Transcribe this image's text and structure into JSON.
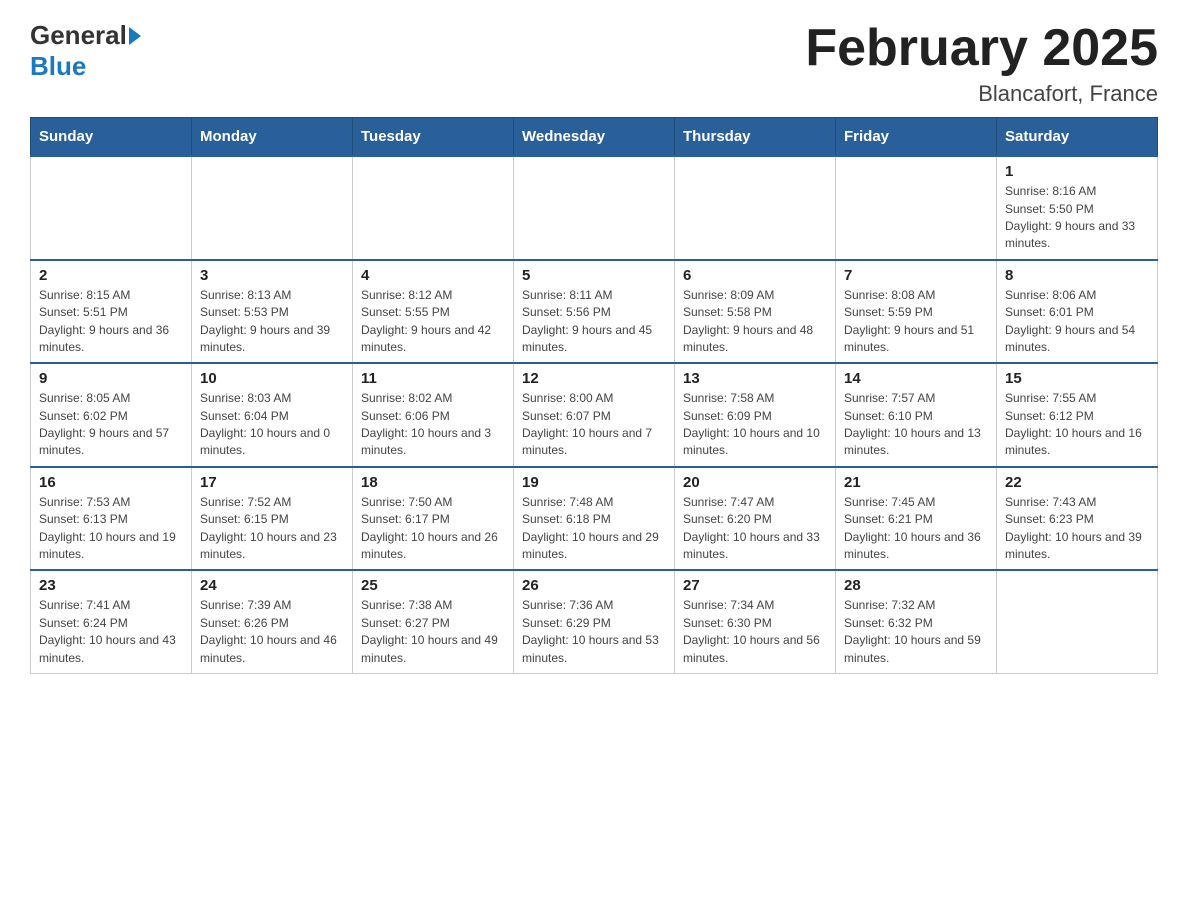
{
  "header": {
    "logo_general": "General",
    "logo_blue": "Blue",
    "month_title": "February 2025",
    "location": "Blancafort, France"
  },
  "days_of_week": [
    "Sunday",
    "Monday",
    "Tuesday",
    "Wednesday",
    "Thursday",
    "Friday",
    "Saturday"
  ],
  "weeks": [
    {
      "cells": [
        {
          "day": "",
          "info": ""
        },
        {
          "day": "",
          "info": ""
        },
        {
          "day": "",
          "info": ""
        },
        {
          "day": "",
          "info": ""
        },
        {
          "day": "",
          "info": ""
        },
        {
          "day": "",
          "info": ""
        },
        {
          "day": "1",
          "info": "Sunrise: 8:16 AM\nSunset: 5:50 PM\nDaylight: 9 hours and 33 minutes."
        }
      ]
    },
    {
      "cells": [
        {
          "day": "2",
          "info": "Sunrise: 8:15 AM\nSunset: 5:51 PM\nDaylight: 9 hours and 36 minutes."
        },
        {
          "day": "3",
          "info": "Sunrise: 8:13 AM\nSunset: 5:53 PM\nDaylight: 9 hours and 39 minutes."
        },
        {
          "day": "4",
          "info": "Sunrise: 8:12 AM\nSunset: 5:55 PM\nDaylight: 9 hours and 42 minutes."
        },
        {
          "day": "5",
          "info": "Sunrise: 8:11 AM\nSunset: 5:56 PM\nDaylight: 9 hours and 45 minutes."
        },
        {
          "day": "6",
          "info": "Sunrise: 8:09 AM\nSunset: 5:58 PM\nDaylight: 9 hours and 48 minutes."
        },
        {
          "day": "7",
          "info": "Sunrise: 8:08 AM\nSunset: 5:59 PM\nDaylight: 9 hours and 51 minutes."
        },
        {
          "day": "8",
          "info": "Sunrise: 8:06 AM\nSunset: 6:01 PM\nDaylight: 9 hours and 54 minutes."
        }
      ]
    },
    {
      "cells": [
        {
          "day": "9",
          "info": "Sunrise: 8:05 AM\nSunset: 6:02 PM\nDaylight: 9 hours and 57 minutes."
        },
        {
          "day": "10",
          "info": "Sunrise: 8:03 AM\nSunset: 6:04 PM\nDaylight: 10 hours and 0 minutes."
        },
        {
          "day": "11",
          "info": "Sunrise: 8:02 AM\nSunset: 6:06 PM\nDaylight: 10 hours and 3 minutes."
        },
        {
          "day": "12",
          "info": "Sunrise: 8:00 AM\nSunset: 6:07 PM\nDaylight: 10 hours and 7 minutes."
        },
        {
          "day": "13",
          "info": "Sunrise: 7:58 AM\nSunset: 6:09 PM\nDaylight: 10 hours and 10 minutes."
        },
        {
          "day": "14",
          "info": "Sunrise: 7:57 AM\nSunset: 6:10 PM\nDaylight: 10 hours and 13 minutes."
        },
        {
          "day": "15",
          "info": "Sunrise: 7:55 AM\nSunset: 6:12 PM\nDaylight: 10 hours and 16 minutes."
        }
      ]
    },
    {
      "cells": [
        {
          "day": "16",
          "info": "Sunrise: 7:53 AM\nSunset: 6:13 PM\nDaylight: 10 hours and 19 minutes."
        },
        {
          "day": "17",
          "info": "Sunrise: 7:52 AM\nSunset: 6:15 PM\nDaylight: 10 hours and 23 minutes."
        },
        {
          "day": "18",
          "info": "Sunrise: 7:50 AM\nSunset: 6:17 PM\nDaylight: 10 hours and 26 minutes."
        },
        {
          "day": "19",
          "info": "Sunrise: 7:48 AM\nSunset: 6:18 PM\nDaylight: 10 hours and 29 minutes."
        },
        {
          "day": "20",
          "info": "Sunrise: 7:47 AM\nSunset: 6:20 PM\nDaylight: 10 hours and 33 minutes."
        },
        {
          "day": "21",
          "info": "Sunrise: 7:45 AM\nSunset: 6:21 PM\nDaylight: 10 hours and 36 minutes."
        },
        {
          "day": "22",
          "info": "Sunrise: 7:43 AM\nSunset: 6:23 PM\nDaylight: 10 hours and 39 minutes."
        }
      ]
    },
    {
      "cells": [
        {
          "day": "23",
          "info": "Sunrise: 7:41 AM\nSunset: 6:24 PM\nDaylight: 10 hours and 43 minutes."
        },
        {
          "day": "24",
          "info": "Sunrise: 7:39 AM\nSunset: 6:26 PM\nDaylight: 10 hours and 46 minutes."
        },
        {
          "day": "25",
          "info": "Sunrise: 7:38 AM\nSunset: 6:27 PM\nDaylight: 10 hours and 49 minutes."
        },
        {
          "day": "26",
          "info": "Sunrise: 7:36 AM\nSunset: 6:29 PM\nDaylight: 10 hours and 53 minutes."
        },
        {
          "day": "27",
          "info": "Sunrise: 7:34 AM\nSunset: 6:30 PM\nDaylight: 10 hours and 56 minutes."
        },
        {
          "day": "28",
          "info": "Sunrise: 7:32 AM\nSunset: 6:32 PM\nDaylight: 10 hours and 59 minutes."
        },
        {
          "day": "",
          "info": ""
        }
      ]
    }
  ]
}
